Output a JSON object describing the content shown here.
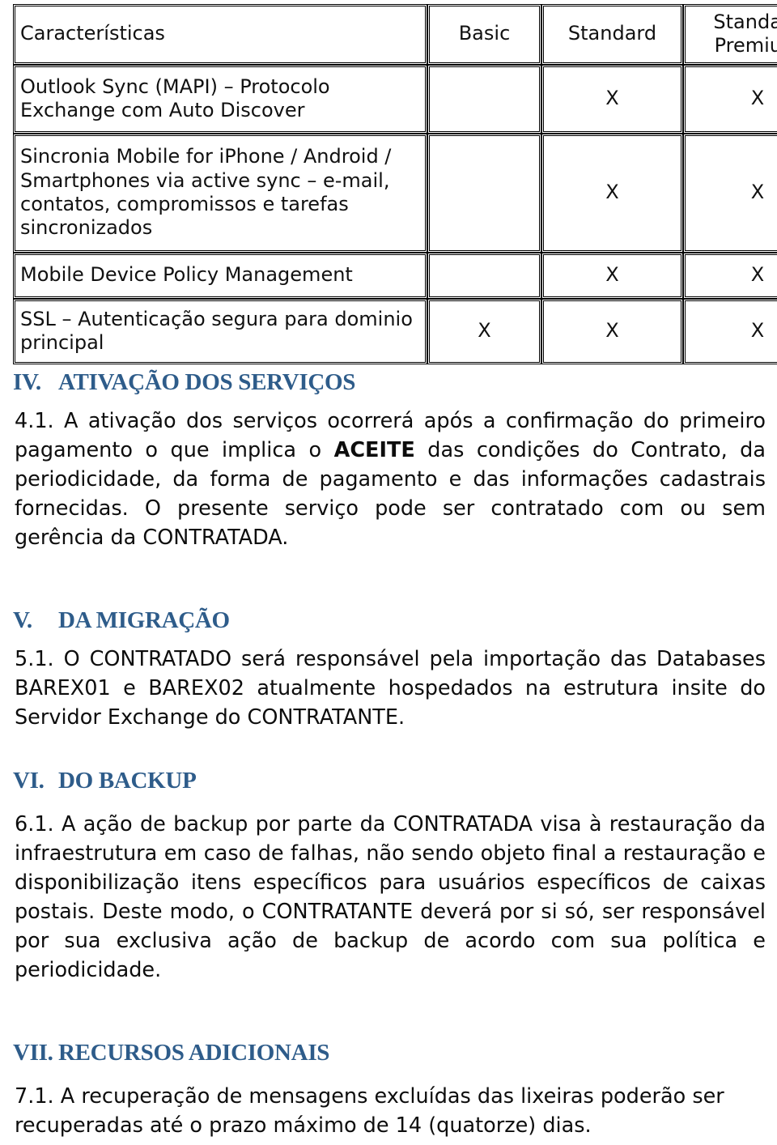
{
  "table": {
    "name": "comparativo-de-planos",
    "columns": [
      "Características",
      "Basic",
      "Standard",
      "Standard\nPremium"
    ],
    "headers": {
      "feature": "Características",
      "basic": "Basic",
      "standard": "Standard",
      "premium_line1": "Standard",
      "premium_line2": "Premium"
    },
    "mark": "X",
    "rows": [
      {
        "feature": "Outlook Sync (MAPI) – Protocolo Exchange com Auto Discover",
        "basic": "",
        "standard": "X",
        "premium": "X"
      },
      {
        "feature": "Sincronia Mobile for iPhone / Android / Smartphones via active sync – e-mail, contatos, compromissos e tarefas sincronizados",
        "basic": "",
        "standard": "X",
        "premium": "X"
      },
      {
        "feature": "Mobile Device Policy Management",
        "basic": "",
        "standard": "X",
        "premium": "X"
      },
      {
        "feature": "SSL – Autenticação segura para dominio principal",
        "basic": "X",
        "standard": "X",
        "premium": "X"
      }
    ]
  },
  "sections": [
    {
      "numeral": "IV.",
      "title": "ATIVAÇÃO DOS SERVIÇOS",
      "clause_number": "4.1.",
      "body_before_bold": "4.1. A ativação dos serviços ocorrerá após a confirmação do primeiro pagamento o que implica o ",
      "body_bold": "ACEITE",
      "body_after_bold": " das condições do Contrato, da periodicidade, da forma de pagamento e das informações cadastrais fornecidas.  O presente serviço pode ser contratado com ou sem gerência da CONTRATADA."
    },
    {
      "numeral": "V.",
      "title": "DA MIGRAÇÃO",
      "clause_number": "5.1.",
      "body": "5.1. O CONTRATADO será responsável pela importação das Databases BAREX01 e BAREX02 atualmente hospedados na estrutura insite do Servidor Exchange do CONTRATANTE."
    },
    {
      "numeral": "VI.",
      "title": "DO BACKUP",
      "clause_number": "6.1.",
      "body": "6.1.  A ação de backup por parte da CONTRATADA visa à restauração da infraestrutura em caso de falhas, não sendo objeto final a restauração e disponibilização itens específicos para usuários específicos de caixas postais. Deste modo, o CONTRATANTE deverá por si só, ser responsável por sua exclusiva ação de backup de acordo com sua política e periodicidade."
    },
    {
      "numeral": "VII.",
      "title": "RECURSOS ADICIONAIS",
      "clause_number": "7.1.",
      "body": "7.1.  A recuperação de mensagens excluídas das lixeiras poderão ser recuperadas até o prazo máximo de 14 (quatorze) dias."
    }
  ],
  "colors": {
    "heading": "#2E5C8A",
    "body_text": "#0d0d0d",
    "table_border": "#000000",
    "page_background": "#ffffff"
  }
}
